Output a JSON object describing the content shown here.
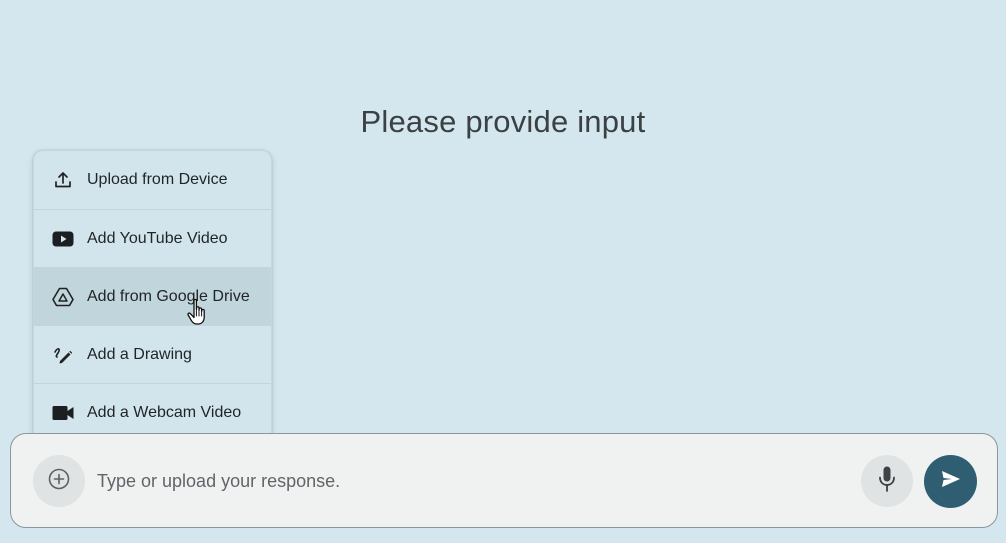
{
  "prompt": {
    "title": "Please provide input"
  },
  "upload_menu": {
    "items": [
      {
        "label": "Upload from Device",
        "icon": "upload-icon"
      },
      {
        "label": "Add YouTube Video",
        "icon": "youtube-icon"
      },
      {
        "label": "Add from Google Drive",
        "icon": "google-drive-icon",
        "hovered": true
      },
      {
        "label": "Add a Drawing",
        "icon": "drawing-icon"
      },
      {
        "label": "Add a Webcam Video",
        "icon": "webcam-icon"
      }
    ]
  },
  "input_bar": {
    "placeholder": "Type or upload your response.",
    "value": "",
    "add_icon": "add-circle-icon",
    "mic_icon": "microphone-icon",
    "send_icon": "send-icon"
  },
  "colors": {
    "background": "#d4e7ee",
    "send_button": "#2f5d72",
    "menu_hover": "#c1d5dc"
  }
}
